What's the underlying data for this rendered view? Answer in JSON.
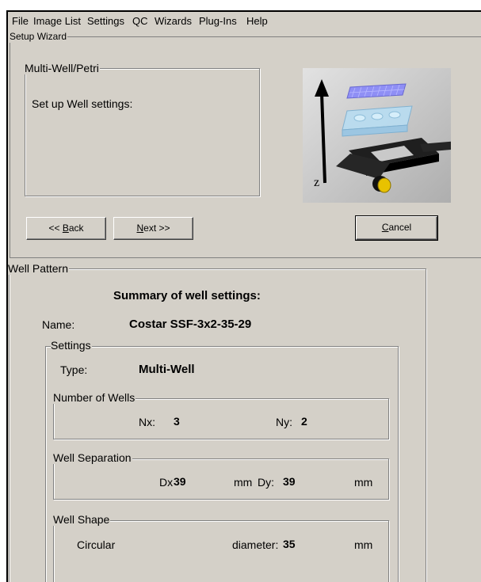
{
  "menu": [
    "File",
    "Image List",
    "Settings",
    "QC",
    "Wizards",
    "Plug-Ins",
    "Help"
  ],
  "wizard": {
    "title": "Setup Wizard",
    "step_group": "Multi-Well/Petri",
    "instruction": "Set up Well settings:",
    "z_axis_label": "z",
    "back": {
      "prefix": "<< ",
      "key": "B",
      "rest": "ack"
    },
    "next": {
      "key": "N",
      "rest": "ext >>"
    },
    "cancel": {
      "key": "C",
      "rest": "ancel"
    }
  },
  "well_pattern": {
    "title": "Well Pattern",
    "summary_heading": "Summary of well settings:",
    "name_label": "Name:",
    "name_value": "Costar SSF-3x2-35-29",
    "settings": {
      "title": "Settings",
      "type_label": "Type:",
      "type_value": "Multi-Well",
      "number_of_wells": {
        "title": "Number of Wells",
        "nx_label": "Nx:",
        "nx_value": "3",
        "ny_label": "Ny:",
        "ny_value": "2"
      },
      "well_separation": {
        "title": "Well Separation",
        "dx_label": "Dx",
        "dx_value": "39",
        "dx_unit": "mm",
        "dy_label": "Dy:",
        "dy_value": "39",
        "dy_unit": "mm"
      },
      "well_shape": {
        "title": "Well Shape",
        "shape": "Circular",
        "diameter_label": "diameter:",
        "diameter_value": "35",
        "diameter_unit": "mm"
      }
    }
  }
}
